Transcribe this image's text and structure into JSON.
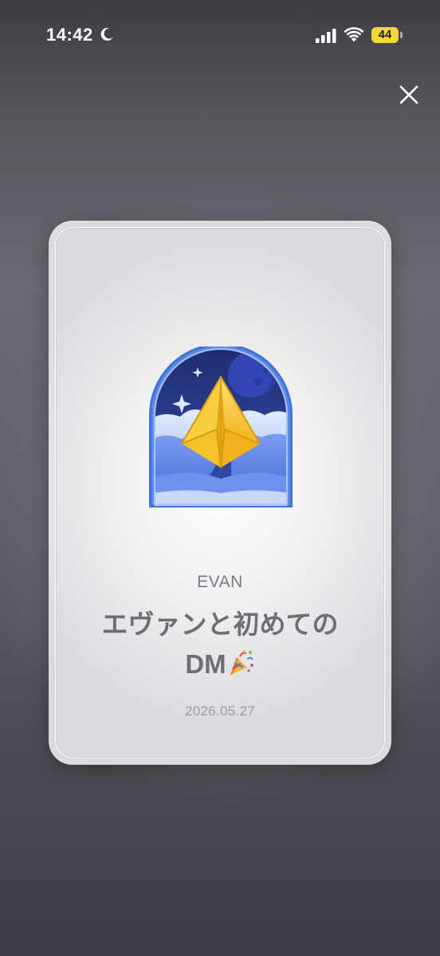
{
  "status_bar": {
    "time": "14:42",
    "battery_level": "44",
    "icons": [
      "moon-icon",
      "signal-icon",
      "wifi-icon",
      "battery-icon"
    ]
  },
  "header": {
    "close_icon": "close-icon"
  },
  "card": {
    "badge_icon": "paper-plane-night-sky-badge",
    "subtitle": "EVAN",
    "title_line1": "エヴァンと初めての",
    "title_line2": "DM",
    "title_emoji_icon": "party-popper-icon",
    "date": "2026.05.27"
  },
  "colors": {
    "badge_frame": "#3b6fd6",
    "badge_sky": "#1e2f7a",
    "badge_plane": "#f2c230",
    "battery": "#f5d73a",
    "title_text": "#6f6f73"
  }
}
